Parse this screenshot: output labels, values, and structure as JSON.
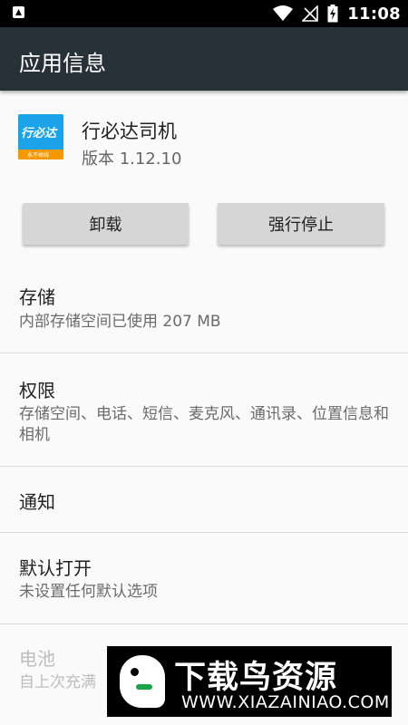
{
  "status_bar": {
    "time": "11:08",
    "notification_icon": "a-icon",
    "icons": [
      "wifi-icon",
      "no-signal-icon",
      "battery-charging-icon"
    ]
  },
  "toolbar": {
    "title": "应用信息"
  },
  "app": {
    "name": "行必达司机",
    "version": "版本 1.12.10",
    "icon_text": "行必达",
    "icon_subtext": "永不掉线"
  },
  "buttons": {
    "uninstall": "卸载",
    "force_stop": "强行停止"
  },
  "sections": {
    "storage": {
      "title": "存储",
      "subtitle": "内部存储空间已使用 207 MB"
    },
    "permissions": {
      "title": "权限",
      "subtitle": "存储空间、电话、短信、麦克风、通讯录、位置信息和相机"
    },
    "notifications": {
      "title": "通知"
    },
    "open_by_default": {
      "title": "默认打开",
      "subtitle": "未设置任何默认选项"
    },
    "battery": {
      "title": "电池",
      "subtitle": "自上次充满"
    }
  },
  "watermark": {
    "title": "下载鸟资源",
    "url": "WWW.XIAZAINIAO.COM"
  },
  "colors": {
    "toolbar": "#263238",
    "button": "#d6d6d6",
    "app_icon": "#1aa3e8",
    "app_icon_stripe": "#f39800"
  }
}
